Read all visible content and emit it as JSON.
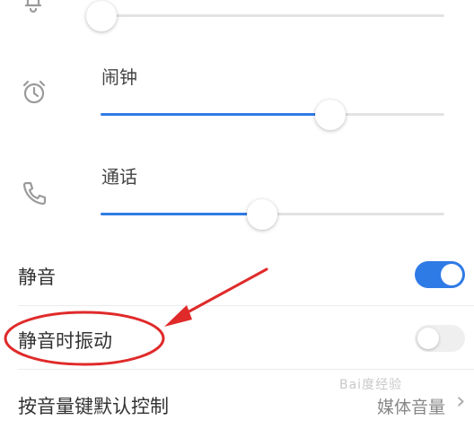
{
  "sliders": [
    {
      "name": "",
      "icon": "bell-off-icon",
      "level": 0
    },
    {
      "name": "闹钟",
      "icon": "alarm-clock-icon",
      "level": 0.67
    },
    {
      "name": "通话",
      "icon": "phone-icon",
      "level": 0.47
    }
  ],
  "toggles": [
    {
      "label": "静音",
      "state": true
    },
    {
      "label": "静音时振动",
      "state": false
    }
  ],
  "volume_key_row": {
    "label": "按音量键默认控制",
    "value": "媒体音量"
  },
  "watermark": "Bai度经验",
  "colors": {
    "accent": "#2f7be6",
    "annotation": "#e02a2a"
  }
}
